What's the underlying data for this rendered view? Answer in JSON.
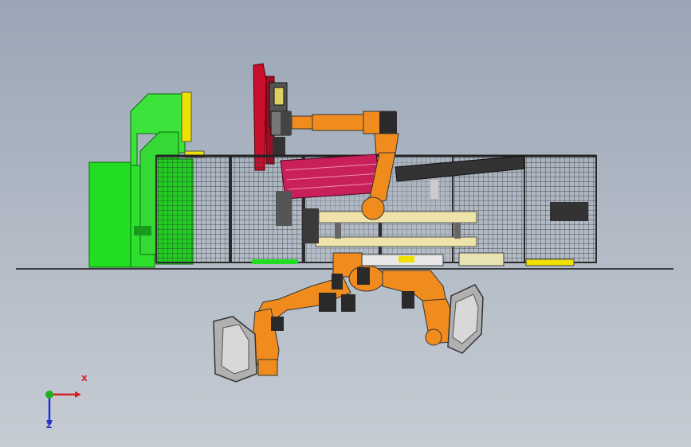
{
  "viewport": {
    "background_top": "#9aa6b6",
    "background_bottom": "#c6ccd4"
  },
  "colors": {
    "robot_orange": "#f08c1e",
    "robot_dark": "#2a2a2a",
    "machine_green": "#22dd22",
    "crane_red": "#c8102e",
    "conveyor_magenta": "#c8205a",
    "fence_grey": "#3c3c3c",
    "beige": "#eee3a8",
    "yellow": "#f0e000"
  },
  "orientation_triad": {
    "x_label": "X",
    "z_label": "Z",
    "x_color": "#d42020",
    "y_color": "#20b020",
    "z_color": "#2333c8"
  }
}
